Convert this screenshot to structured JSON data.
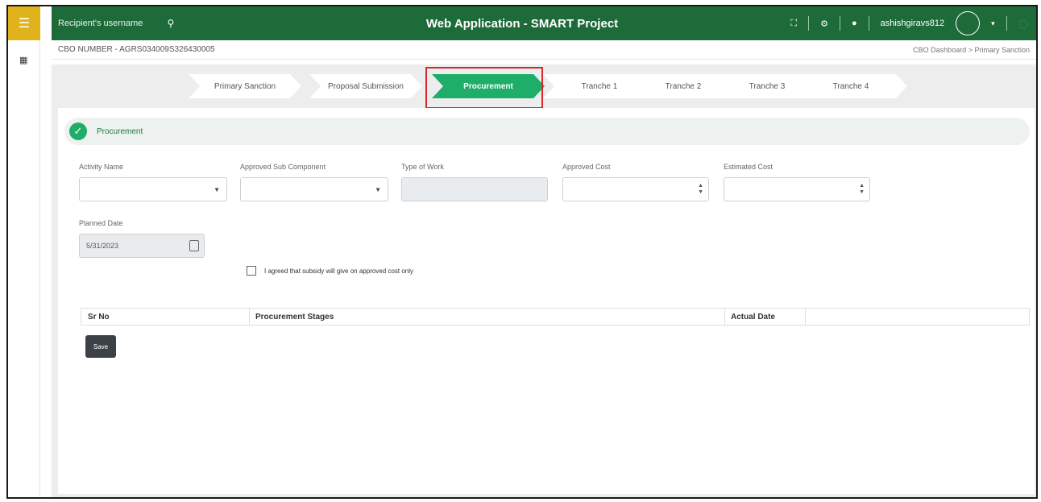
{
  "topbar": {
    "search_placeholder": "Recipient's username",
    "app_title": "Web Application - SMART Project",
    "username": "ashishgiravs812"
  },
  "icons": {
    "hamburger": "menu-icon",
    "search": "search-icon",
    "fullscreen": "fullscreen-icon",
    "settings": "gear-icon",
    "notifications": "bell-icon",
    "grid": "grid-icon"
  },
  "header": {
    "cbo_number": "CBO NUMBER - AGRS034009S326430005",
    "breadcrumb": "CBO Dashboard  >  Primary Sanction"
  },
  "steps": [
    {
      "label": "Primary Sanction",
      "active": false
    },
    {
      "label": "Proposal Submission",
      "active": false
    },
    {
      "label": "Procurement",
      "active": true
    },
    {
      "label": "Tranche 1",
      "active": false
    },
    {
      "label": "Tranche 2",
      "active": false
    },
    {
      "label": "Tranche 3",
      "active": false
    },
    {
      "label": "Tranche 4",
      "active": false
    }
  ],
  "section": {
    "title": "Procurement"
  },
  "form": {
    "activity_name": {
      "label": "Activity Name",
      "value": ""
    },
    "approved_sub_component": {
      "label": "Approved Sub Component",
      "value": ""
    },
    "type_of_work": {
      "label": "Type of Work",
      "value": ""
    },
    "approved_cost": {
      "label": "Approved Cost",
      "value": ""
    },
    "estimated_cost": {
      "label": "Estimated Cost",
      "value": ""
    },
    "planned_date": {
      "label": "Planned Date",
      "value": "5/31/2023"
    },
    "agree_text": "I agreed that subsidy will give on approved cost only",
    "agree_checked": false
  },
  "table": {
    "columns": [
      "Sr No",
      "Procurement Stages",
      "Actual Date"
    ],
    "rows": []
  },
  "buttons": {
    "save": "Save"
  },
  "colors": {
    "topbar": "#1e6b3a",
    "accent": "#1fae6a",
    "hamburger_bg": "#e0b21b",
    "highlight": "#d62828"
  }
}
